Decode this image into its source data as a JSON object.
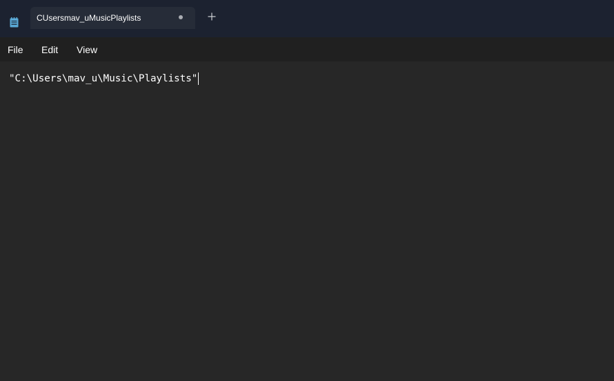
{
  "tab": {
    "title": "CUsersmav_uMusicPlaylists",
    "unsaved_indicator": "dot"
  },
  "icons": {
    "app": "notepad-icon",
    "new_tab": "plus-icon"
  },
  "menu": {
    "file": "File",
    "edit": "Edit",
    "view": "View"
  },
  "editor": {
    "content": "\"C:\\Users\\mav_u\\Music\\Playlists\""
  },
  "colors": {
    "titlebar": "#1c2230",
    "tab": "#262c38",
    "menubar": "#202020",
    "editor_bg": "#272727",
    "text": "#ffffff",
    "icon_accent": "#5aa9d6"
  }
}
